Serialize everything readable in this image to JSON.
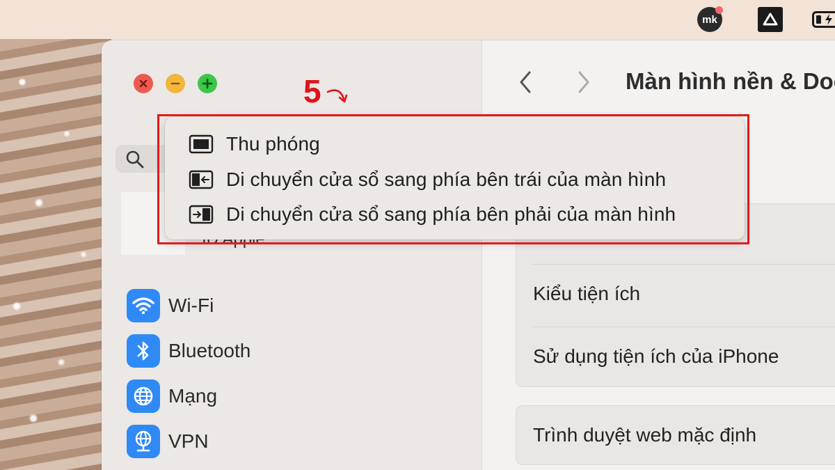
{
  "menubar": {
    "icons": [
      "mk-app-icon",
      "drive-icon",
      "battery-charging-icon"
    ],
    "mk_text": "mk"
  },
  "window": {
    "sidebar": {
      "apple_id_label": "ID Apple",
      "items": [
        {
          "label": "Wi-Fi",
          "icon": "wifi-icon"
        },
        {
          "label": "Bluetooth",
          "icon": "bluetooth-icon"
        },
        {
          "label": "Mạng",
          "icon": "network-globe-icon"
        },
        {
          "label": "VPN",
          "icon": "vpn-globe-icon"
        }
      ]
    },
    "content": {
      "title": "Màn hình nền & Dock",
      "rows": [
        "Kiểu tiện ích",
        "Sử dụng tiện ích của iPhone",
        "Trình duyệt web mặc định"
      ],
      "checkbox_checked": true
    }
  },
  "popup": {
    "items": [
      {
        "label": "Thu phóng",
        "icon": "zoom-window-icon"
      },
      {
        "label": "Di chuyển cửa sổ sang phía bên trái của màn hình",
        "icon": "move-left-icon"
      },
      {
        "label": "Di chuyển cửa sổ sang phía bên phải của màn hình",
        "icon": "move-right-icon"
      }
    ]
  },
  "annotation": {
    "step": "5",
    "color": "#e0141a"
  },
  "colors": {
    "accent_blue": "#2f8af6",
    "close": "#ee5a52",
    "minimize": "#f3b53d",
    "maximize": "#3cc748"
  }
}
